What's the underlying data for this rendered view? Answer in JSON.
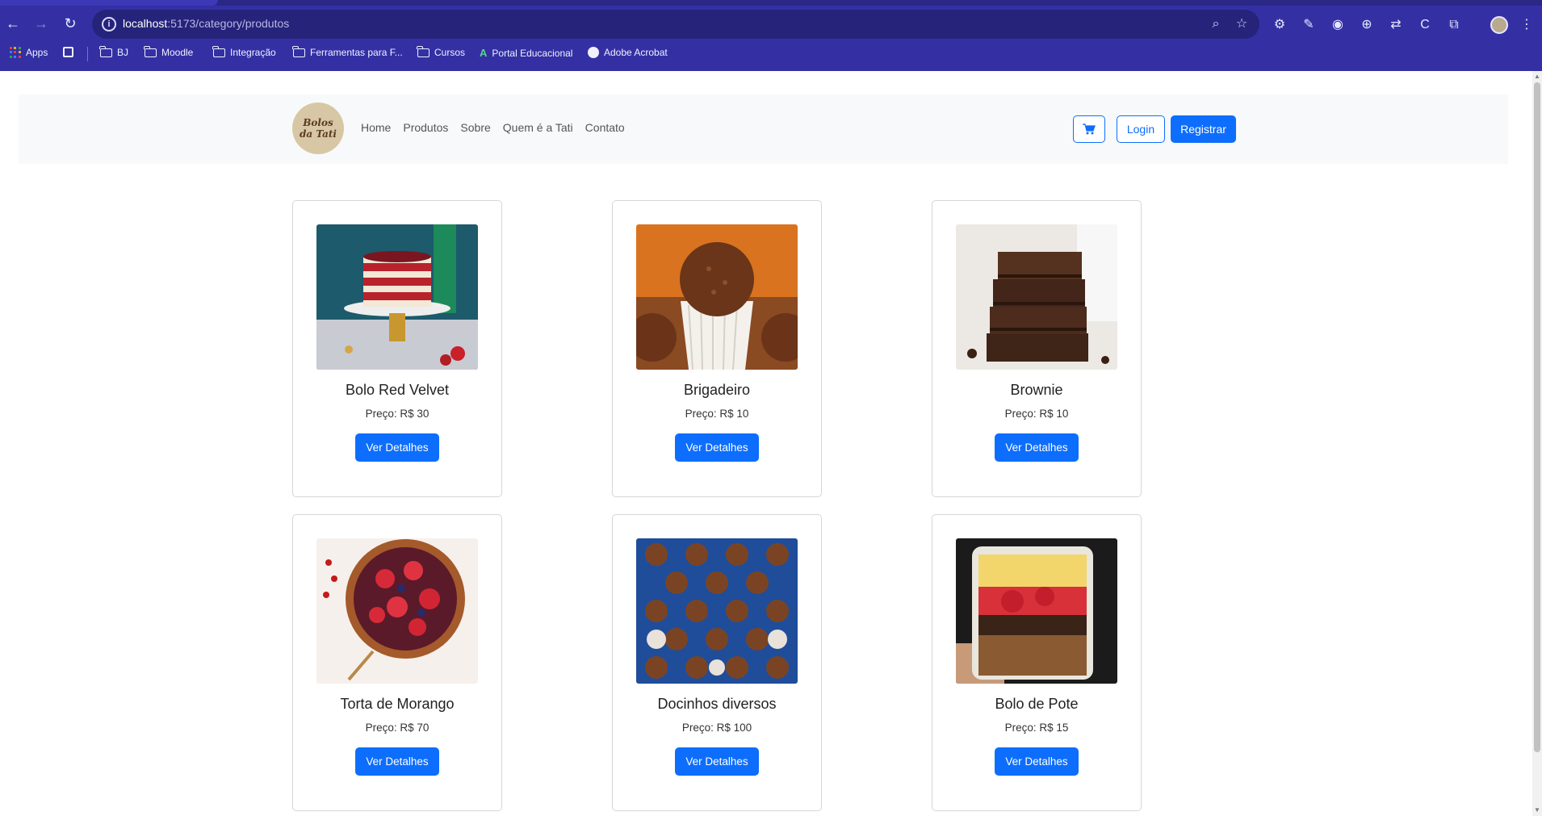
{
  "browser": {
    "url_host": "localhost",
    "url_path": ":5173/category/produtos",
    "bookmarks": [
      "Apps",
      "BJ",
      "Moodle",
      "Integração",
      "Ferramentas para F...",
      "Cursos",
      "Portal Educacional",
      "Adobe Acrobat"
    ]
  },
  "navbar": {
    "logo_text": "Bolos da Tati",
    "links": [
      "Home",
      "Produtos",
      "Sobre",
      "Quem é a Tati",
      "Contato"
    ],
    "login": "Login",
    "register": "Registrar"
  },
  "products": [
    {
      "name": "Bolo Red Velvet",
      "price": "Preço: R$ 30",
      "button": "Ver Detalhes"
    },
    {
      "name": "Brigadeiro",
      "price": "Preço: R$ 10",
      "button": "Ver Detalhes"
    },
    {
      "name": "Brownie",
      "price": "Preço: R$ 10",
      "button": "Ver Detalhes"
    },
    {
      "name": "Torta de Morango",
      "price": "Preço: R$ 70",
      "button": "Ver Detalhes"
    },
    {
      "name": "Docinhos diversos",
      "price": "Preço: R$ 100",
      "button": "Ver Detalhes"
    },
    {
      "name": "Bolo de Pote",
      "price": "Preço: R$ 15",
      "button": "Ver Detalhes"
    }
  ],
  "colors": {
    "primary": "#0d6efd",
    "chrome": "#3430a4"
  }
}
